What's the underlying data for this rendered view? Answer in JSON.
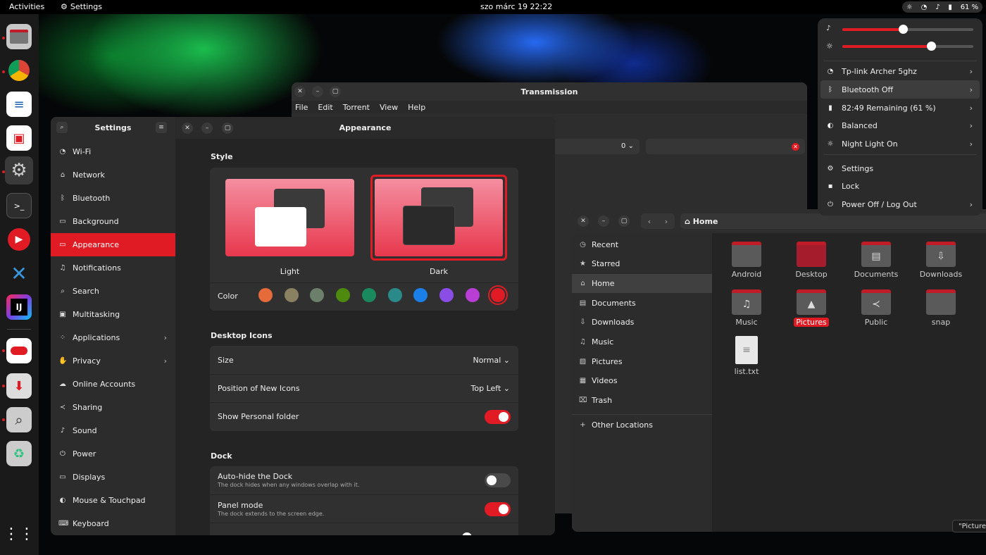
{
  "topbar": {
    "activities": "Activities",
    "app_name": "Settings",
    "clock": "szo márc 19  22:22",
    "battery": "61 %"
  },
  "transmission": {
    "title": "Transmission",
    "menu": [
      "File",
      "Edit",
      "Torrent",
      "View",
      "Help"
    ],
    "filter_value": "0"
  },
  "settings": {
    "sidebar_title": "Settings",
    "page_title": "Appearance",
    "nav": [
      "Wi-Fi",
      "Network",
      "Bluetooth",
      "Background",
      "Appearance",
      "Notifications",
      "Search",
      "Multitasking",
      "Applications",
      "Privacy",
      "Online Accounts",
      "Sharing",
      "Sound",
      "Power",
      "Displays",
      "Mouse & Touchpad",
      "Keyboard"
    ],
    "style_heading": "Style",
    "style_light": "Light",
    "style_dark": "Dark",
    "color_label": "Color",
    "accent_colors": [
      "#e66b3a",
      "#8a8062",
      "#6b7f6b",
      "#4e8a0e",
      "#1a8a5e",
      "#2a8a8a",
      "#1a7fe6",
      "#8a4ee6",
      "#b83ed6",
      "#e01b24"
    ],
    "desktop_icons_heading": "Desktop Icons",
    "size_label": "Size",
    "size_value": "Normal",
    "position_label": "Position of New Icons",
    "position_value": "Top Left",
    "personal_folder_label": "Show Personal folder",
    "dock_heading": "Dock",
    "autohide_label": "Auto-hide the Dock",
    "autohide_desc": "The dock hides when any windows overlap with it.",
    "panel_label": "Panel mode",
    "panel_desc": "The dock extends to the screen edge."
  },
  "files": {
    "location": "Home",
    "sidebar": [
      "Recent",
      "Starred",
      "Home",
      "Documents",
      "Downloads",
      "Music",
      "Pictures",
      "Videos",
      "Trash"
    ],
    "other_locations": "Other Locations",
    "items": [
      "Android",
      "Desktop",
      "Documents",
      "Downloads",
      "Music",
      "Pictures",
      "Public",
      "snap",
      "list.txt"
    ]
  },
  "quick_settings": {
    "volume": 0.46,
    "brightness": 0.68,
    "wifi": "Tp-link Archer 5ghz",
    "bluetooth": "Bluetooth Off",
    "battery": "82:49 Remaining (61 %)",
    "power_mode": "Balanced",
    "night_light": "Night Light On",
    "settings": "Settings",
    "lock": "Lock",
    "power": "Power Off / Log Out"
  },
  "tooltip": "\"Picture"
}
